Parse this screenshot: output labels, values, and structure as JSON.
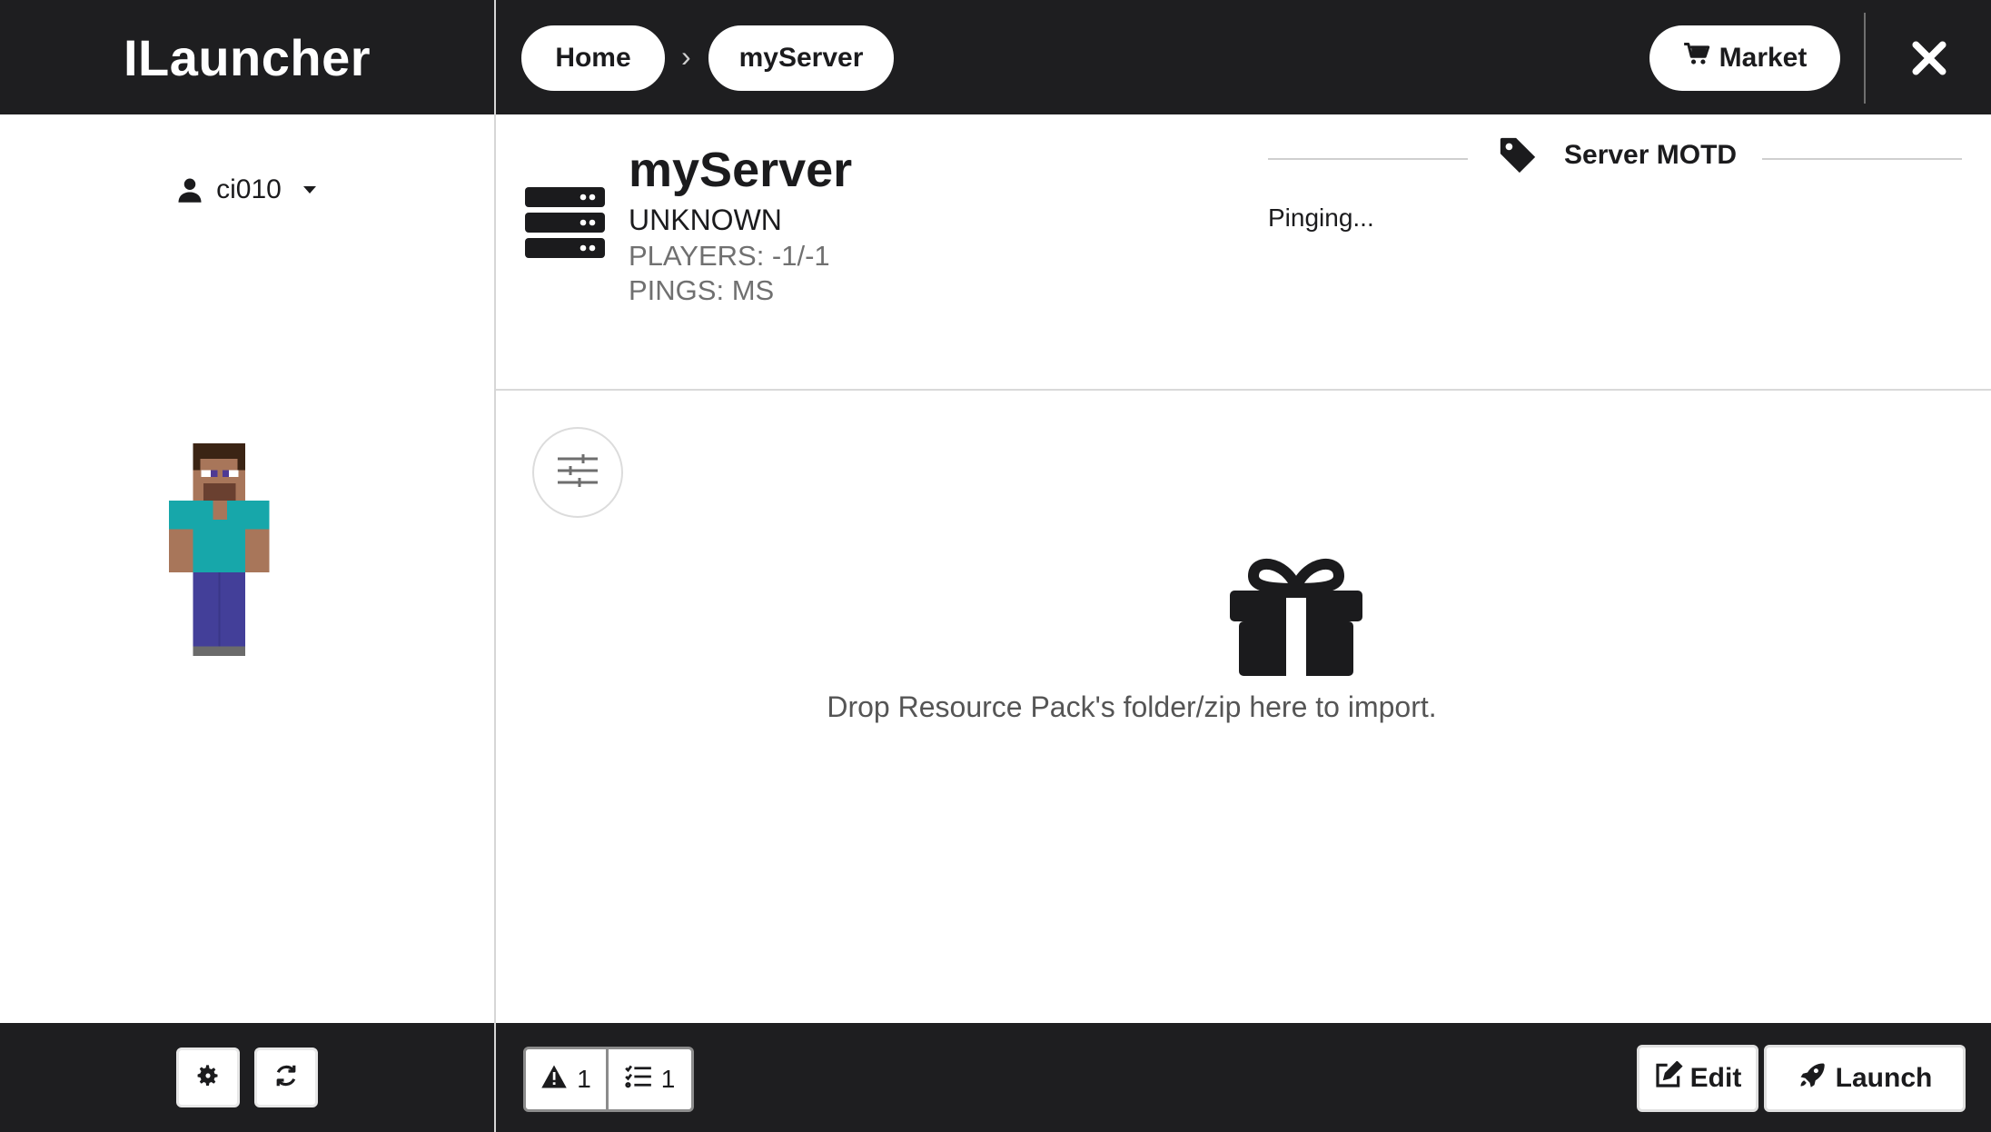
{
  "app": {
    "title": "ILauncher"
  },
  "user": {
    "name": "ci010"
  },
  "breadcrumb": {
    "home": "Home",
    "current": "myServer"
  },
  "header": {
    "market_label": "Market"
  },
  "server": {
    "name": "myServer",
    "status": "UNKNOWN",
    "players": "PLAYERS: -1/-1",
    "pings": "PINGS: MS"
  },
  "motd": {
    "title": "Server MOTD",
    "text": "Pinging..."
  },
  "dropzone": {
    "text": "Drop Resource Pack's folder/zip here to import."
  },
  "footer": {
    "warnings_count": "1",
    "tasks_count": "1",
    "edit_label": "Edit",
    "launch_label": "Launch"
  },
  "colors": {
    "dark_bar": "#1e1e20",
    "accent_white": "#ffffff",
    "muted_text": "#707070"
  },
  "icons": [
    "user-icon",
    "caret-down-icon",
    "gear-icon",
    "refresh-icon",
    "cart-icon",
    "close-icon",
    "server-icon",
    "tag-icon",
    "sliders-icon",
    "gift-icon",
    "warning-icon",
    "tasks-icon",
    "edit-icon",
    "rocket-icon"
  ]
}
